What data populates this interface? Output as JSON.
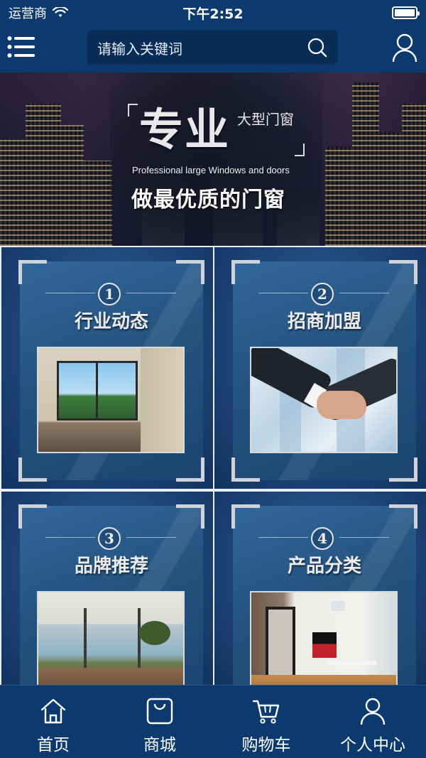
{
  "status_bar": {
    "carrier": "运营商",
    "time": "下午2:52"
  },
  "header": {
    "search_placeholder": "请输入关键词"
  },
  "banner": {
    "title": "专业",
    "subtitle": "大型门窗",
    "english": "Professional large Windows and doors",
    "slogan": "做最优质的门窗"
  },
  "tiles": [
    {
      "number": "1",
      "title": "行业动态"
    },
    {
      "number": "2",
      "title": "招商加盟"
    },
    {
      "number": "3",
      "title": "品牌推荐"
    },
    {
      "number": "4",
      "title": "产品分类"
    }
  ],
  "bottom_nav": [
    {
      "label": "首页",
      "icon": "home-icon"
    },
    {
      "label": "商城",
      "icon": "shopping-bag-icon"
    },
    {
      "label": "购物车",
      "icon": "cart-icon"
    },
    {
      "label": "个人中心",
      "icon": "user-icon"
    }
  ],
  "colors": {
    "primary": "#0d3a6e",
    "tile": "#1d4577"
  }
}
